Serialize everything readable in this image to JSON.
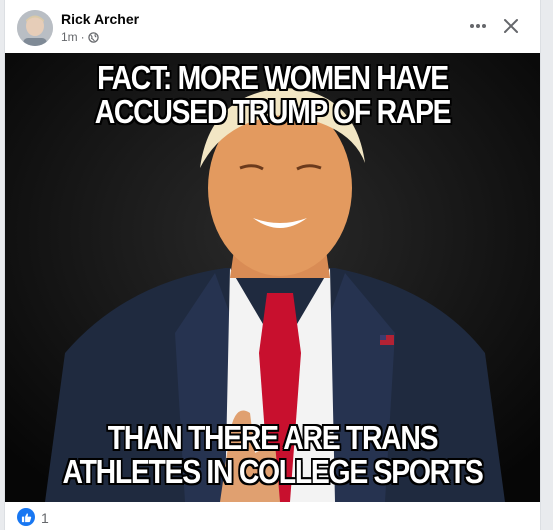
{
  "post": {
    "author": "Rick Archer",
    "time": "1m",
    "separator": "·",
    "privacy_icon": "globe-icon",
    "more_icon": "more-horizontal-icon",
    "close_icon": "close-icon"
  },
  "image": {
    "top_caption_line1": "FACT: MORE WOMEN HAVE",
    "top_caption_line2": "ACCUSED TRUMP OF RAPE",
    "bottom_caption_line1": "THAN THERE ARE TRANS",
    "bottom_caption_line2": "ATHLETES IN COLLEGE SPORTS"
  },
  "reactions": {
    "icon": "like-icon",
    "count": "1"
  },
  "colors": {
    "like_blue": "#1877f2",
    "secondary_text": "#65676b"
  }
}
